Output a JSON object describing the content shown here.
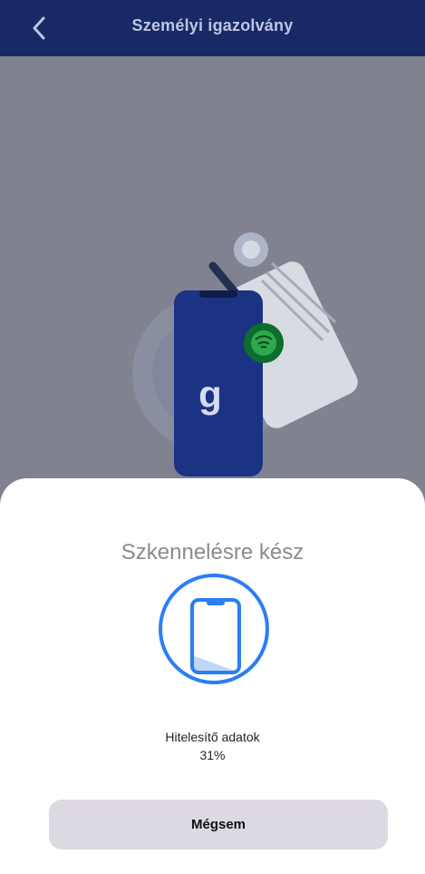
{
  "header": {
    "title": "Személyi igazolvány"
  },
  "sheet": {
    "title": "Szkennelésre kész",
    "progress_label": "Hitelesítő adatok",
    "progress_percent": "31%",
    "cancel_label": "Mégsem"
  },
  "colors": {
    "header_bg": "#172a65",
    "accent": "#2b7ef3",
    "overlay": "#7f8491",
    "sheet_bg": "#ffffff",
    "button_bg": "#ddd9e2"
  },
  "icons": {
    "back": "chevron-left-icon",
    "phone": "phone-outline-icon",
    "nfc": "nfc-icon"
  }
}
